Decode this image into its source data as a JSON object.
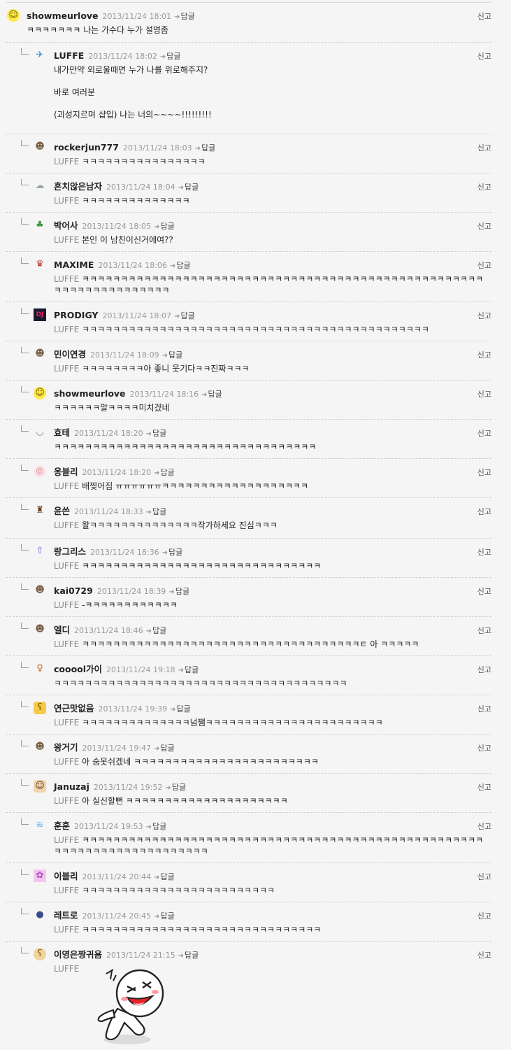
{
  "report_label": "신고",
  "reply_label": "답글",
  "comments": [
    {
      "nick": "showmeurlove",
      "date": "2013/11/24 18:01",
      "mention": "",
      "text": "ㅋㅋㅋㅋㅋㅋㅋ 나는 가수다 누가 설명좀",
      "avatar_icon": "smiley-icon"
    },
    {
      "nick": "LUFFE",
      "date": "2013/11/24 18:02",
      "mention": "",
      "text": "내가만약 외로울때면 누가 나를 위로해주지?\n\n바로 여러분\n\n(괴성지르며 샵입) 나는 너의~~~~!!!!!!!!!",
      "avatar_icon": "bird-icon"
    },
    {
      "nick": "rockerjun777",
      "date": "2013/11/24 18:03",
      "mention": "LUFFE",
      "text": "ㅋㅋㅋㅋㅋㅋㅋㅋㅋㅋㅋㅋㅋㅋㅋㅋ",
      "avatar_icon": "face-icon"
    },
    {
      "nick": "흔치않은남자",
      "date": "2013/11/24 18:04",
      "mention": "LUFFE",
      "text": "ㅋㅋㅋㅋㅋㅋㅋㅋㅋㅋㅋㅋㅋㅋ",
      "avatar_icon": "ghost-icon"
    },
    {
      "nick": "박어사",
      "date": "2013/11/24 18:05",
      "mention": "LUFFE",
      "text": "본인 이 남친이신거에여??",
      "avatar_icon": "tree-icon"
    },
    {
      "nick": "MAXIME",
      "date": "2013/11/24 18:06",
      "mention": "LUFFE",
      "text": "ㅋㅋㅋㅋㅋㅋㅋㅋㅋㅋㅋㅋㅋㅋㅋㅋㅋㅋㅋㅋㅋㅋㅋㅋㅋㅋㅋㅋㅋㅋㅋㅋㅋㅋㅋㅋㅋㅋㅋㅋㅋㅋㅋㅋㅋㅋㅋㅋㅋㅋㅋㅋㅋㅋㅋㅋㅋㅋㅋㅋㅋㅋㅋㅋㅋㅋㅋ",
      "avatar_icon": "crown-icon"
    },
    {
      "nick": "PRODIGY",
      "date": "2013/11/24 18:07",
      "mention": "LUFFE",
      "text": "ㅋㅋㅋㅋㅋㅋㅋㅋㅋㅋㅋㅋㅋㅋㅋㅋㅋㅋㅋㅋㅋㅋㅋㅋㅋㅋㅋㅋㅋㅋㅋㅋㅋㅋㅋㅋㅋㅋㅋㅋㅋㅋㅋㅋㅋ",
      "avatar_icon": "dj-icon"
    },
    {
      "nick": "민이연경",
      "date": "2013/11/24 18:09",
      "mention": "LUFFE",
      "text": "ㅋㅋㅋㅋㅋㅋㅋㅋ아 좋니 웃기다ㅋㅋ진짜ㅋㅋㅋ",
      "avatar_icon": "face-icon"
    },
    {
      "nick": "showmeurlove",
      "date": "2013/11/24 18:16",
      "mention": "",
      "text": "ㅋㅋㅋㅋㅋㅋ알ㅋㅋㅋㅋ미치겠네",
      "avatar_icon": "smiley-icon"
    },
    {
      "nick": "효테",
      "date": "2013/11/24 18:20",
      "mention": "",
      "text": "ㅋㅋㅋㅋㅋㅋㅋㅋㅋㅋㅋㅋㅋㅋㅋㅋㅋㅋㅋㅋㅋㅋㅋㅋㅋㅋㅋㅋㅋㅋㅋㅋㅋㅋ",
      "avatar_icon": "smile-line-icon"
    },
    {
      "nick": "옹블리",
      "date": "2013/11/24 18:20",
      "mention": "LUFFE",
      "text": "배찢어짐 ㅠㅠㅠㅠㅠㅠㅋㅋㅋㅋㅋㅋㅋㅋㅋㅋㅋㅋㅋㅋㅋㅋㅋㅋㅋ",
      "avatar_icon": "egg-face-icon"
    },
    {
      "nick": "윤쓴",
      "date": "2013/11/24 18:33",
      "mention": "LUFFE",
      "text": "왈ㅋㅋㅋㅋㅋㅋㅋㅋㅋㅋㅋㅋㅋㅋ작가하세요 진심ㅋㅋㅋ",
      "avatar_icon": "person-icon"
    },
    {
      "nick": "랑그리스",
      "date": "2013/11/24 18:36",
      "mention": "LUFFE",
      "text": "ㅋㅋㅋㅋㅋㅋㅋㅋㅋㅋㅋㅋㅋㅋㅋㅋㅋㅋㅋㅋㅋㅋㅋㅋㅋㅋㅋㅋㅋㅋㅋ",
      "avatar_icon": "arrow-up-icon"
    },
    {
      "nick": "kai0729",
      "date": "2013/11/24 18:39",
      "mention": "LUFFE",
      "text": "-ㅋㅋㅋㅋㅋㅋㅋㅋㅋㅋㅋㅋ",
      "avatar_icon": "face-icon"
    },
    {
      "nick": "엘디",
      "date": "2013/11/24 18:46",
      "mention": "LUFFE",
      "text": "ㅋㅋㅋㅋㅋㅋㅋㅋㅋㅋㅋㅋㅋㅋㅋㅋㅋㅋㅋㅋㅋㅋㅋㅋㅋㅋㅋㅋㅋㅋㅋㅋㅋㅋㅋㅋㅌ 아 ㅋㅋㅋㅋㅋ",
      "avatar_icon": "face-icon"
    },
    {
      "nick": "cooool가이",
      "date": "2013/11/24 19:18",
      "mention": "",
      "text": "ㅋㅋㅋㅋㅋㅋㅋㅋㅋㅋㅋㅋㅋㅋㅋㅋㅋㅋㅋㅋㅋㅋㅋㅋㅋㅋㅋㅋㅋㅋㅋㅋㅋㅋㅋㅋㅋㅋ",
      "avatar_icon": "girl-icon"
    },
    {
      "nick": "연근맛없음",
      "date": "2013/11/24 19:39",
      "mention": "LUFFE",
      "text": "ㅋㅋㅋㅋㅋㅋㅋㅋㅋㅋㅋㅋㅋㅋ넘쨈ㅋㅋㅋㅋㅋㅋㅋㅋㅋㅋㅋㅋㅋㅋㅋㅋㅋㅋㅋㅋㅋㅋㅋ",
      "avatar_icon": "bear-icon"
    },
    {
      "nick": "왕거기",
      "date": "2013/11/24 19:47",
      "mention": "LUFFE",
      "text": "아 숨못쉬겠네 ㅋㅋㅋㅋㅋㅋㅋㅋㅋㅋㅋㅋㅋㅋㅋㅋㅋㅋㅋㅋㅋㅋㅋㅋ",
      "avatar_icon": "face-icon"
    },
    {
      "nick": "Januzaj",
      "date": "2013/11/24 19:52",
      "mention": "LUFFE",
      "text": "아 실신할뻔 ㅋㅋㅋㅋㅋㅋㅋㅋㅋㅋㅋㅋㅋㅋㅋㅋㅋㅋㅋㅋㅋ",
      "avatar_icon": "boy-icon"
    },
    {
      "nick": "훈훈",
      "date": "2013/11/24 19:53",
      "mention": "LUFFE",
      "text": "ㅋㅋㅋㅋㅋㅋㅋㅋㅋㅋㅋㅋㅋㅋㅋㅋㅋㅋㅋㅋㅋㅋㅋㅋㅋㅋㅋㅋㅋㅋㅋㅋㅋㅋㅋㅋㅋㅋㅋㅋㅋㅋㅋㅋㅋㅋㅋㅋㅋㅋㅋㅋㅋㅋㅋㅋㅋㅋㅋㅋㅋㅋㅋㅋㅋㅋㅋㅋㅋㅋㅋㅋ",
      "avatar_icon": "wave-icon"
    },
    {
      "nick": "이블리",
      "date": "2013/11/24 20:44",
      "mention": "LUFFE",
      "text": "ㅋㅋㅋㅋㅋㅋㅋㅋㅋㅋㅋㅋㅋㅋㅋㅋㅋㅋㅋㅋㅋㅋㅋㅋㅋ",
      "avatar_icon": "flower-icon"
    },
    {
      "nick": "레트로",
      "date": "2013/11/24 20:45",
      "mention": "LUFFE",
      "text": "ㅋㅋㅋㅋㅋㅋㅋㅋㅋㅋㅋㅋㅋㅋㅋㅋㅋㅋㅋㅋㅋㅋㅋㅋㅋㅋㅋㅋㅋㅋㅋ",
      "avatar_icon": "cap-icon"
    },
    {
      "nick": "이영은짱귀욤",
      "date": "2013/11/24 21:15",
      "mention": "LUFFE",
      "text": "",
      "avatar_icon": "bear-face-icon"
    }
  ]
}
